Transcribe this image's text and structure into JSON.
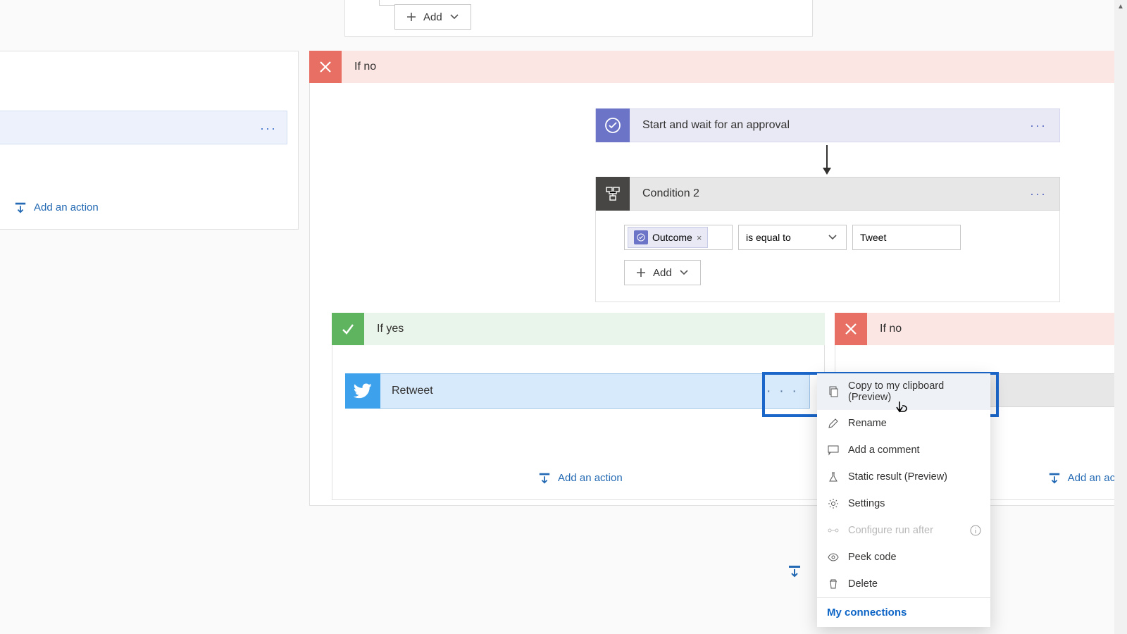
{
  "top_add": "Add",
  "left": {
    "add_action": "Add an action"
  },
  "ifno_main": {
    "label": "If no"
  },
  "approval": {
    "title": "Start and wait for an approval"
  },
  "condition": {
    "title": "Condition 2",
    "token": "Outcome",
    "op": "is equal to",
    "value": "Tweet",
    "add": "Add"
  },
  "ifyes": {
    "label": "If yes",
    "add_action": "Add an action"
  },
  "retweet": {
    "title": "Retweet"
  },
  "ifno_nested": {
    "label": "If no",
    "add_action": "Add an actio"
  },
  "ctx": {
    "copy": "Copy to my clipboard (Preview)",
    "rename": "Rename",
    "comment": "Add a comment",
    "static": "Static result (Preview)",
    "settings": "Settings",
    "configure": "Configure run after",
    "peek": "Peek code",
    "delete": "Delete",
    "connections": "My connections"
  }
}
